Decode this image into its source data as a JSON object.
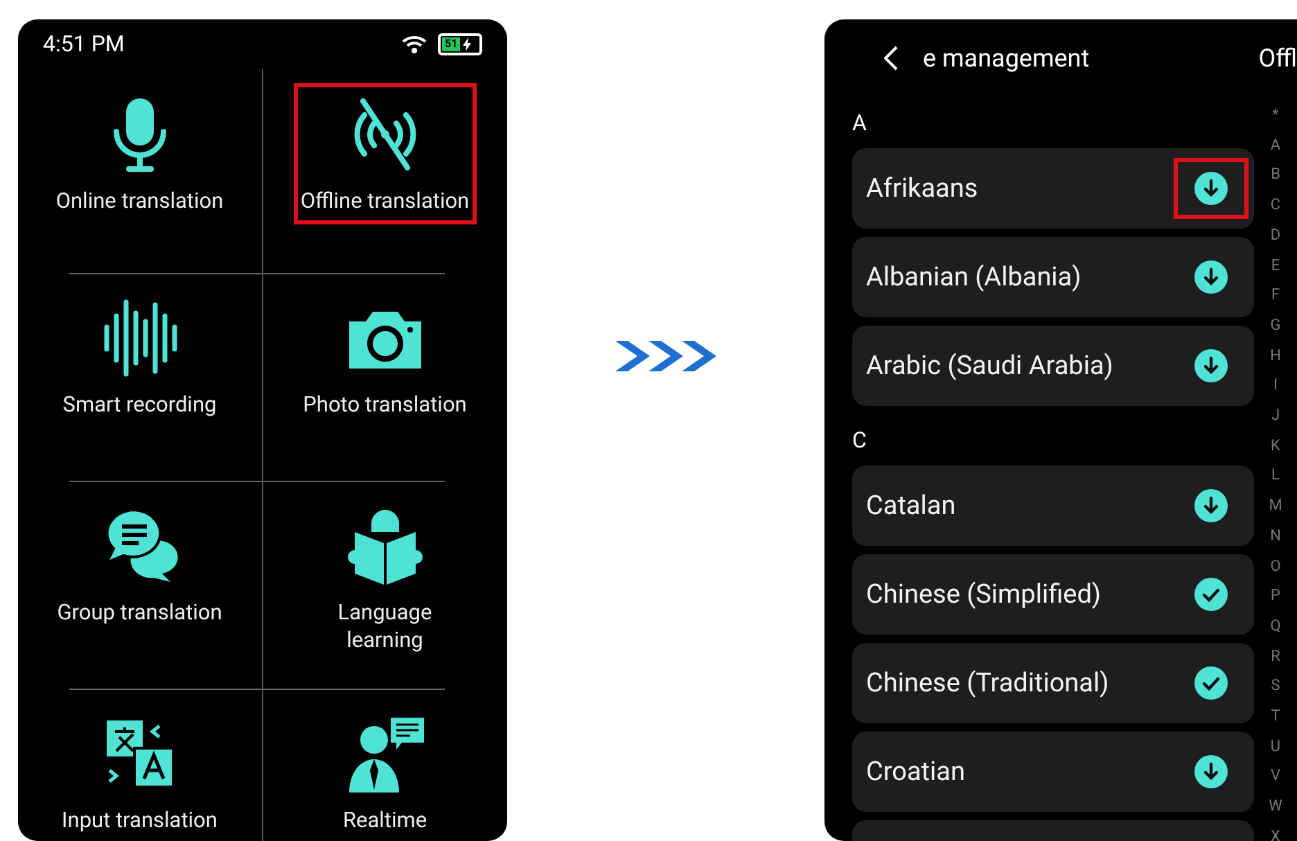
{
  "home_screen": {
    "status_bar": {
      "time": "4:51 PM",
      "battery": "51"
    },
    "features": [
      {
        "label": "Online translation",
        "highlighted": false
      },
      {
        "label": "Offline translation",
        "highlighted": true
      },
      {
        "label": "Smart recording",
        "highlighted": false
      },
      {
        "label": "Photo translation",
        "highlighted": false
      },
      {
        "label": "Group translation",
        "highlighted": false
      },
      {
        "label": "Language\nlearning",
        "highlighted": false
      },
      {
        "label": "Input translation",
        "highlighted": false
      },
      {
        "label": "Realtime",
        "highlighted": false
      }
    ]
  },
  "language_screen": {
    "title": "e management",
    "tab": "Offl",
    "sections": [
      {
        "letter": "A",
        "items": [
          {
            "name": "Afrikaans",
            "downloaded": false,
            "highlighted": true
          },
          {
            "name": "Albanian (Albania)",
            "downloaded": false
          },
          {
            "name": "Arabic (Saudi Arabia)",
            "downloaded": false
          }
        ]
      },
      {
        "letter": "C",
        "items": [
          {
            "name": "Catalan",
            "downloaded": false
          },
          {
            "name": "Chinese (Simplified)",
            "downloaded": true
          },
          {
            "name": "Chinese (Traditional)",
            "downloaded": true
          },
          {
            "name": "Croatian",
            "downloaded": false
          }
        ]
      }
    ],
    "index": [
      "*",
      "A",
      "B",
      "C",
      "D",
      "E",
      "F",
      "G",
      "H",
      "I",
      "J",
      "K",
      "L",
      "M",
      "N",
      "O",
      "P",
      "Q",
      "R",
      "S",
      "T",
      "U",
      "V",
      "W",
      "X"
    ]
  }
}
